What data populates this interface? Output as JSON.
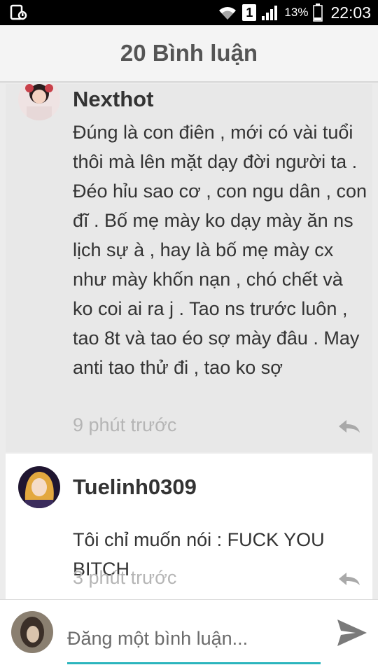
{
  "status_bar": {
    "sim": "1",
    "battery": "13%",
    "time": "22:03"
  },
  "header": {
    "title": "20 Bình luận"
  },
  "comments": [
    {
      "author": "Nexthot",
      "text": "Đúng là con điên , mới có vài tuổi thôi mà lên mặt dạy đời người ta . Đéo hỉu sao cơ , con ngu dân , con đĩ . Bố mẹ mày ko dạy mày ăn ns lịch sự à , hay là bố mẹ mày cx như mày khốn nạn , chó chết và ko coi ai ra j . Tao ns trước luôn , tao 8t và tao éo sợ mày đâu . May anti tao thử đi , tao ko sợ",
      "time": "9 phút trước",
      "avatar_icon": "girl-avatar",
      "reply_icon": "reply-icon"
    },
    {
      "author": "Tuelinh0309",
      "text": "Tôi chỉ muốn nói  : FUCK YOU BITCH",
      "time": "3 phút trước",
      "avatar_icon": "anime-avatar",
      "reply_icon": "reply-icon"
    }
  ],
  "composer": {
    "placeholder": "Đăng một bình luận...",
    "value": "",
    "accent": "#2bb5bd",
    "send_icon": "send-icon"
  }
}
